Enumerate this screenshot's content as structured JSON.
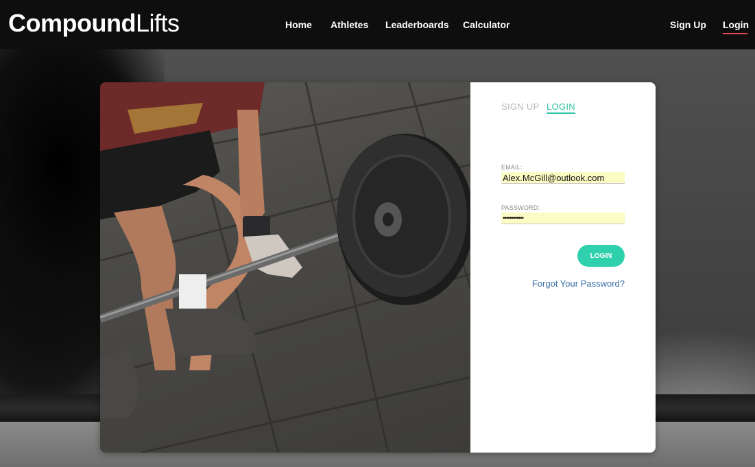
{
  "brand": {
    "bold": "Compound",
    "light": "Lifts"
  },
  "nav": {
    "items": [
      "Home",
      "Athletes",
      "Leaderboards",
      "Calculator"
    ]
  },
  "auth": {
    "signup": "Sign Up",
    "login": "Login"
  },
  "form": {
    "tabs": {
      "signup": "SIGN UP",
      "login": "LOGIN"
    },
    "email_label": "EMAIL:",
    "email_value": "Alex.McGill@outlook.com",
    "password_label": "PASSWORD:",
    "password_value": "••••••••••••",
    "submit_label": "LOGIN",
    "forgot_label": "Forgot Your Password?"
  },
  "colors": {
    "accent": "#2fd0ac",
    "active_underline": "#e44a4a",
    "link": "#3b6fa8",
    "header_bg": "#0e0e0e",
    "autofill_bg": "#fbfbc4"
  }
}
